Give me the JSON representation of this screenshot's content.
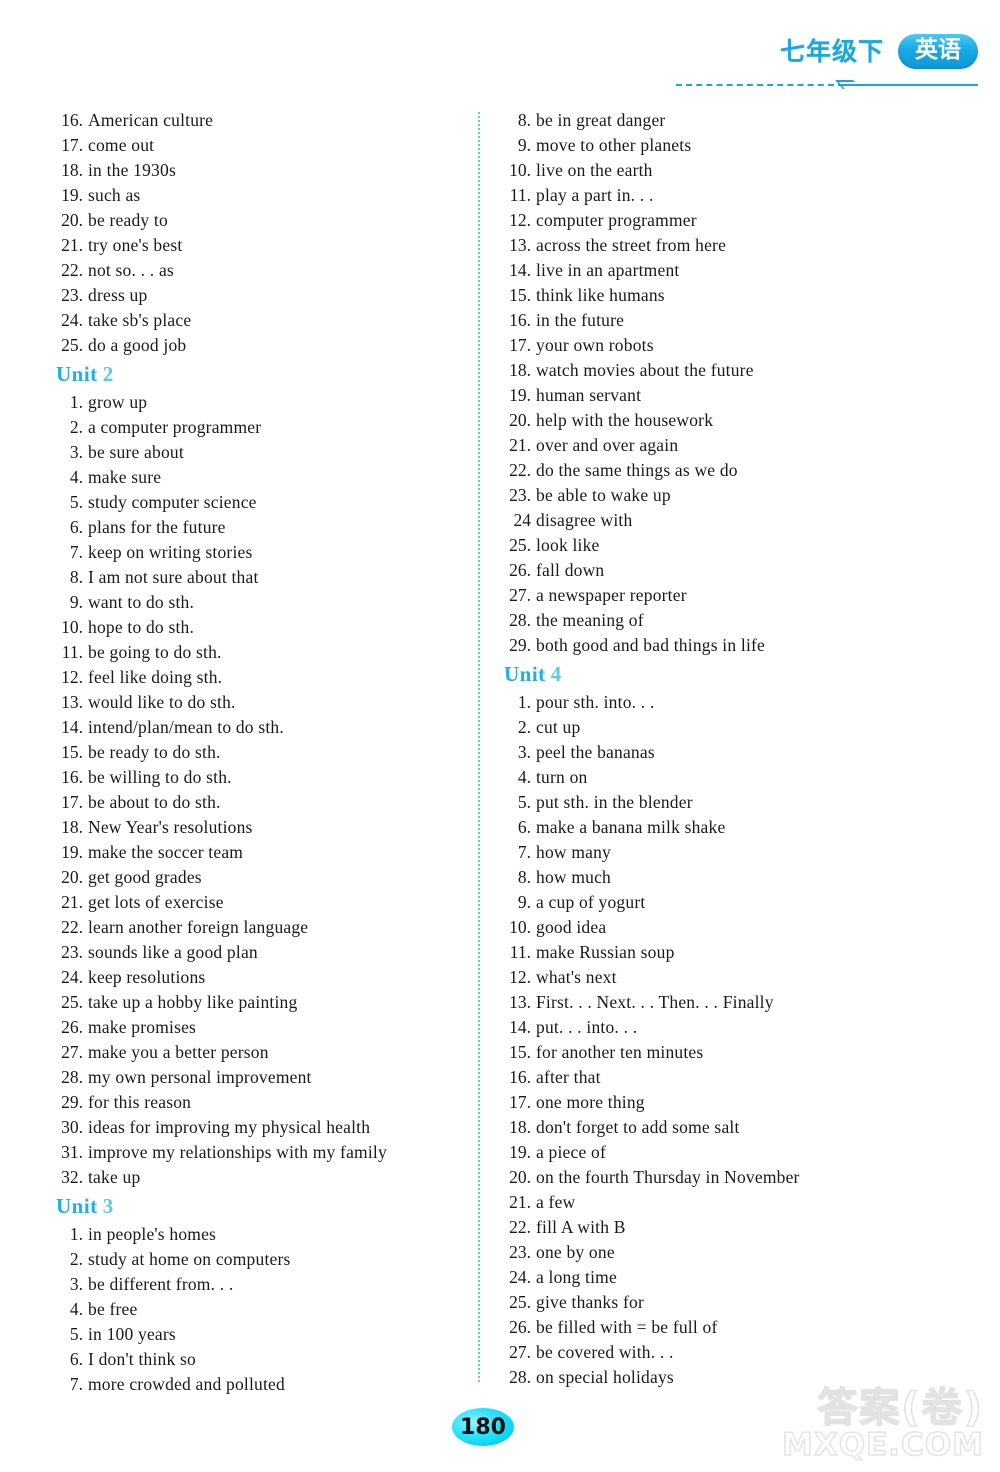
{
  "header": {
    "grade": "七年级下",
    "subject": "英语",
    "subject_char1": "英",
    "subject_char2": "语"
  },
  "colors": {
    "accent": "#1fb0e6",
    "unit_heading": "#1fb0e6",
    "divider": "#5fcdee",
    "page_badge": "#00d4f5",
    "text": "#1a1a1a"
  },
  "left_column": [
    {
      "type": "entry",
      "num": "16.",
      "text": "American culture"
    },
    {
      "type": "entry",
      "num": "17.",
      "text": "come out"
    },
    {
      "type": "entry",
      "num": "18.",
      "text": "in the 1930s"
    },
    {
      "type": "entry",
      "num": "19.",
      "text": "such as"
    },
    {
      "type": "entry",
      "num": "20.",
      "text": "be ready to"
    },
    {
      "type": "entry",
      "num": "21.",
      "text": "try one's best"
    },
    {
      "type": "entry",
      "num": "22.",
      "text": "not so. . . as"
    },
    {
      "type": "entry",
      "num": "23.",
      "text": "dress up"
    },
    {
      "type": "entry",
      "num": "24.",
      "text": "take sb's place"
    },
    {
      "type": "entry",
      "num": "25.",
      "text": "do a good job"
    },
    {
      "type": "unit",
      "word": "Unit",
      "number": "2"
    },
    {
      "type": "entry",
      "num": "1.",
      "text": "grow up"
    },
    {
      "type": "entry",
      "num": "2.",
      "text": "a computer programmer"
    },
    {
      "type": "entry",
      "num": "3.",
      "text": "be sure about"
    },
    {
      "type": "entry",
      "num": "4.",
      "text": "make sure"
    },
    {
      "type": "entry",
      "num": "5.",
      "text": "study computer science"
    },
    {
      "type": "entry",
      "num": "6.",
      "text": "plans for the future"
    },
    {
      "type": "entry",
      "num": "7.",
      "text": "keep on writing stories"
    },
    {
      "type": "entry",
      "num": "8.",
      "text": "I am not sure about that"
    },
    {
      "type": "entry",
      "num": "9.",
      "text": "want to do sth."
    },
    {
      "type": "entry",
      "num": "10.",
      "text": "hope to do sth."
    },
    {
      "type": "entry",
      "num": "11.",
      "text": "be going to do sth."
    },
    {
      "type": "entry",
      "num": "12.",
      "text": "feel like doing sth."
    },
    {
      "type": "entry",
      "num": "13.",
      "text": "would like to do sth."
    },
    {
      "type": "entry",
      "num": "14.",
      "text": "intend/plan/mean to do sth."
    },
    {
      "type": "entry",
      "num": "15.",
      "text": "be ready to do sth."
    },
    {
      "type": "entry",
      "num": "16.",
      "text": "be willing to do sth."
    },
    {
      "type": "entry",
      "num": "17.",
      "text": "be about to do sth."
    },
    {
      "type": "entry",
      "num": "18.",
      "text": "New Year's resolutions"
    },
    {
      "type": "entry",
      "num": "19.",
      "text": "make the soccer team"
    },
    {
      "type": "entry",
      "num": "20.",
      "text": "get good grades"
    },
    {
      "type": "entry",
      "num": "21.",
      "text": "get lots of exercise"
    },
    {
      "type": "entry",
      "num": "22.",
      "text": "learn another foreign language"
    },
    {
      "type": "entry",
      "num": "23.",
      "text": "sounds like a good plan"
    },
    {
      "type": "entry",
      "num": "24.",
      "text": "keep resolutions"
    },
    {
      "type": "entry",
      "num": "25.",
      "text": "take up a hobby like painting"
    },
    {
      "type": "entry",
      "num": "26.",
      "text": "make promises"
    },
    {
      "type": "entry",
      "num": "27.",
      "text": "make you a better person"
    },
    {
      "type": "entry",
      "num": "28.",
      "text": "my own personal improvement"
    },
    {
      "type": "entry",
      "num": "29.",
      "text": "for this reason"
    },
    {
      "type": "entry",
      "num": "30.",
      "text": "ideas for improving my physical health"
    },
    {
      "type": "entry",
      "num": "31.",
      "text": "improve my relationships with my family"
    },
    {
      "type": "entry",
      "num": "32.",
      "text": "take up"
    },
    {
      "type": "unit",
      "word": "Unit",
      "number": "3"
    },
    {
      "type": "entry",
      "num": "1.",
      "text": "in people's homes"
    },
    {
      "type": "entry",
      "num": "2.",
      "text": "study at home on computers"
    },
    {
      "type": "entry",
      "num": "3.",
      "text": "be different from. . ."
    },
    {
      "type": "entry",
      "num": "4.",
      "text": "be free"
    },
    {
      "type": "entry",
      "num": "5.",
      "text": "in 100 years"
    },
    {
      "type": "entry",
      "num": "6.",
      "text": "I don't think so"
    },
    {
      "type": "entry",
      "num": "7.",
      "text": "more crowded and polluted"
    }
  ],
  "right_column": [
    {
      "type": "entry",
      "num": "8.",
      "text": "be in great danger"
    },
    {
      "type": "entry",
      "num": "9.",
      "text": "move to other planets"
    },
    {
      "type": "entry",
      "num": "10.",
      "text": "live on the earth"
    },
    {
      "type": "entry",
      "num": "11.",
      "text": "play a part in. . ."
    },
    {
      "type": "entry",
      "num": "12.",
      "text": "computer programmer"
    },
    {
      "type": "entry",
      "num": "13.",
      "text": "across the street from here"
    },
    {
      "type": "entry",
      "num": "14.",
      "text": "live in an apartment"
    },
    {
      "type": "entry",
      "num": "15.",
      "text": "think like humans"
    },
    {
      "type": "entry",
      "num": "16.",
      "text": "in the future"
    },
    {
      "type": "entry",
      "num": "17.",
      "text": "your own robots"
    },
    {
      "type": "entry",
      "num": "18.",
      "text": "watch movies about the future"
    },
    {
      "type": "entry",
      "num": "19.",
      "text": "human servant"
    },
    {
      "type": "entry",
      "num": "20.",
      "text": "help with the housework"
    },
    {
      "type": "entry",
      "num": "21.",
      "text": "over and over again"
    },
    {
      "type": "entry",
      "num": "22.",
      "text": "do the same things as we do"
    },
    {
      "type": "entry",
      "num": "23.",
      "text": "be able to wake up"
    },
    {
      "type": "entry",
      "num": "24",
      "text": "disagree with"
    },
    {
      "type": "entry",
      "num": "25.",
      "text": "look like"
    },
    {
      "type": "entry",
      "num": "26.",
      "text": "fall down"
    },
    {
      "type": "entry",
      "num": "27.",
      "text": "a newspaper reporter"
    },
    {
      "type": "entry",
      "num": "28.",
      "text": "the meaning of"
    },
    {
      "type": "entry",
      "num": "29.",
      "text": "both good and bad things in life"
    },
    {
      "type": "unit",
      "word": "Unit",
      "number": "4"
    },
    {
      "type": "entry",
      "num": "1.",
      "text": "pour sth.  into. . ."
    },
    {
      "type": "entry",
      "num": "2.",
      "text": "cut up"
    },
    {
      "type": "entry",
      "num": "3.",
      "text": "peel the bananas"
    },
    {
      "type": "entry",
      "num": "4.",
      "text": "turn on"
    },
    {
      "type": "entry",
      "num": "5.",
      "text": "put sth.  in the blender"
    },
    {
      "type": "entry",
      "num": "6.",
      "text": "make a banana milk shake"
    },
    {
      "type": "entry",
      "num": "7.",
      "text": "how many"
    },
    {
      "type": "entry",
      "num": "8.",
      "text": "how much"
    },
    {
      "type": "entry",
      "num": "9.",
      "text": "a cup of yogurt"
    },
    {
      "type": "entry",
      "num": "10.",
      "text": "good idea"
    },
    {
      "type": "entry",
      "num": "11.",
      "text": "make Russian soup"
    },
    {
      "type": "entry",
      "num": "12.",
      "text": "what's next"
    },
    {
      "type": "entry",
      "num": "13.",
      "text": "First. . . Next. . . Then. . . Finally"
    },
    {
      "type": "entry",
      "num": "14.",
      "text": "put. . . into. . ."
    },
    {
      "type": "entry",
      "num": "15.",
      "text": "for another ten minutes"
    },
    {
      "type": "entry",
      "num": "16.",
      "text": "after that"
    },
    {
      "type": "entry",
      "num": "17.",
      "text": "one more thing"
    },
    {
      "type": "entry",
      "num": "18.",
      "text": "don't forget to add some salt"
    },
    {
      "type": "entry",
      "num": "19.",
      "text": "a piece of"
    },
    {
      "type": "entry",
      "num": "20.",
      "text": "on the fourth Thursday in November"
    },
    {
      "type": "entry",
      "num": "21.",
      "text": "a few"
    },
    {
      "type": "entry",
      "num": "22.",
      "text": "fill A with B"
    },
    {
      "type": "entry",
      "num": "23.",
      "text": "one by one"
    },
    {
      "type": "entry",
      "num": "24.",
      "text": "a long time"
    },
    {
      "type": "entry",
      "num": "25.",
      "text": "give thanks for"
    },
    {
      "type": "entry",
      "num": "26.",
      "text": "be filled with = be full of"
    },
    {
      "type": "entry",
      "num": "27.",
      "text": "be covered with. . ."
    },
    {
      "type": "entry",
      "num": "28.",
      "text": "on special holidays"
    }
  ],
  "footer": {
    "page_number": "180",
    "watermark_cn": "答案(卷)",
    "watermark_en": "MXQE.COM"
  }
}
